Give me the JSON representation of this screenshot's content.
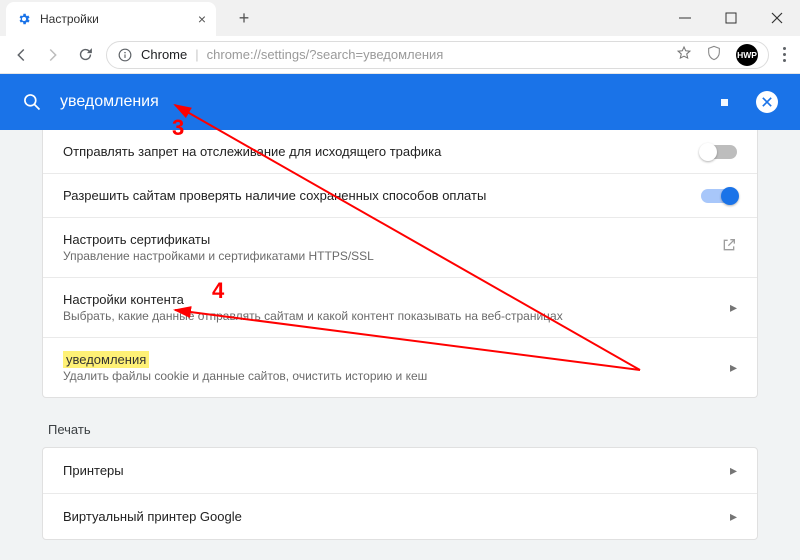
{
  "window": {
    "tab_title": "Настройки",
    "newtab_tooltip": "+"
  },
  "address": {
    "site_label": "Chrome",
    "url_path": "chrome://settings/?search=уведомления",
    "avatar_text": "HWP"
  },
  "search": {
    "value": "уведомления"
  },
  "settings": {
    "rows": [
      {
        "title": "Отправлять запрет на отслеживание для исходящего трафика",
        "sub": "",
        "toggle": "off"
      },
      {
        "title": "Разрешить сайтам проверять наличие сохраненных способов оплаты",
        "sub": "",
        "toggle": "on"
      },
      {
        "title": "Настроить сертификаты",
        "sub": "Управление настройками и сертификатами HTTPS/SSL",
        "action": "external"
      },
      {
        "title": "Настройки контента",
        "sub": "Выбрать, какие данные отправлять сайтам и какой контент показывать на веб-страницах",
        "action": "chev"
      },
      {
        "title_hl": "уведомления",
        "title_rest": "",
        "sub": "Удалить файлы cookie и данные сайтов, очистить историю и кеш",
        "action": "chev",
        "strike_under": "Очистить историю"
      }
    ],
    "section2_header": "Печать",
    "section2_rows": [
      {
        "title": "Принтеры",
        "action": "chev"
      },
      {
        "title": "Виртуальный принтер Google",
        "action": "chev"
      }
    ]
  },
  "annotations": {
    "num3": "3",
    "num4": "4"
  }
}
